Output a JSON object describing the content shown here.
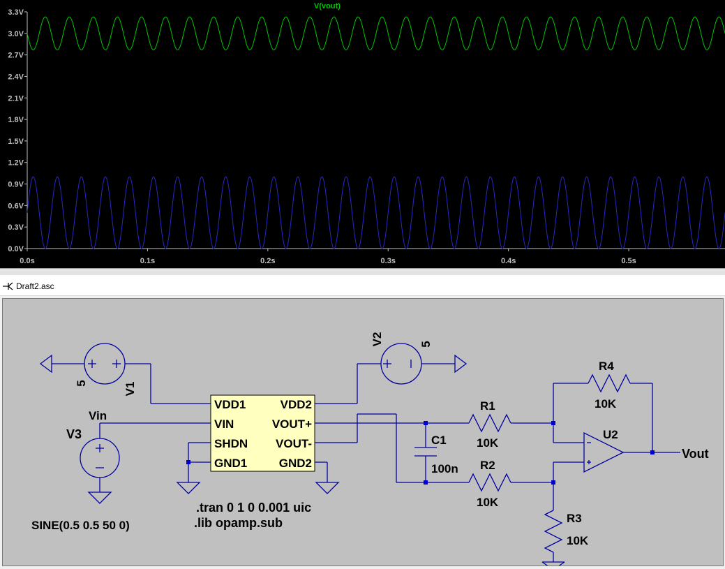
{
  "plot": {
    "trace_name": "V(vout)",
    "trace_color": "#00c800",
    "input_trace_color": "#2828c8",
    "background": "#000000",
    "axis_text_color": "#c0c0c0",
    "y_ticks": [
      "3.3V",
      "3.0V",
      "2.7V",
      "2.4V",
      "2.1V",
      "1.8V",
      "1.5V",
      "1.2V",
      "0.9V",
      "0.6V",
      "0.3V",
      "0.0V"
    ],
    "x_ticks": [
      "0.0s",
      "0.1s",
      "0.2s",
      "0.3s",
      "0.4s",
      "0.5s"
    ],
    "chart_data": {
      "type": "line",
      "xlabel": "",
      "ylabel": "",
      "xlim": [
        0,
        0.58
      ],
      "ylim": [
        0,
        3.3
      ],
      "grid": false,
      "series": [
        {
          "name": "V(vout)",
          "shape": "sine",
          "frequency_hz": 50,
          "offset": 3.0,
          "amplitude": 0.23,
          "color": "#00c800"
        },
        {
          "shape": "sine",
          "frequency_hz": 50,
          "offset": 0.5,
          "amplitude": 0.5,
          "color": "#2828c8"
        }
      ]
    }
  },
  "schematic": {
    "window_title": "Draft2.asc",
    "wire_color": "#0000a0",
    "ic_fill": "#ffffc0",
    "ic_pins_left": [
      "VDD1",
      "VIN",
      "SHDN",
      "GND1"
    ],
    "ic_pins_right": [
      "VDD2",
      "VOUT+",
      "VOUT-",
      "GND2"
    ],
    "labels": {
      "v1_name": "V1",
      "v1_value": "5",
      "v2_name": "V2",
      "v2_value": "5",
      "v3_name": "V3",
      "v3_value": "SINE(0.5 0.5 50 0)",
      "vin_net": "Vin",
      "c1_name": "C1",
      "c1_value": "100n",
      "r1_name": "R1",
      "r1_value": "10K",
      "r2_name": "R2",
      "r2_value": "10K",
      "r3_name": "R3",
      "r3_value": "10K",
      "r4_name": "R4",
      "r4_value": "10K",
      "u2_name": "U2",
      "vout_net": "Vout",
      "directive_tran": ".tran 0 1 0 0.001 uic",
      "directive_lib": ".lib opamp.sub"
    }
  }
}
